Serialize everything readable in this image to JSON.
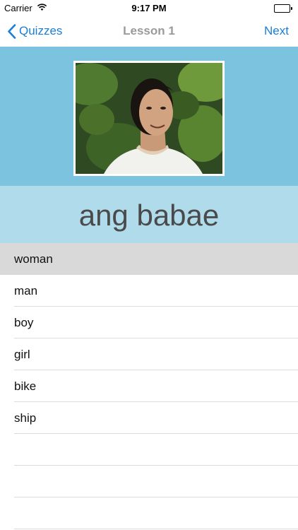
{
  "status_bar": {
    "carrier": "Carrier",
    "time": "9:17 PM",
    "wifi_icon": "wifi-icon",
    "battery_icon": "battery-icon"
  },
  "nav": {
    "back_label": "Quizzes",
    "title": "Lesson 1",
    "next_label": "Next",
    "accent_color": "#1a7ed8"
  },
  "question": {
    "word": "ang babae",
    "photo_icon": "woman-portrait-photo"
  },
  "answers": [
    {
      "label": "woman",
      "selected": true
    },
    {
      "label": "man",
      "selected": false
    },
    {
      "label": "boy",
      "selected": false
    },
    {
      "label": "girl",
      "selected": false
    },
    {
      "label": "bike",
      "selected": false
    },
    {
      "label": "ship",
      "selected": false
    }
  ],
  "colors": {
    "photo_panel": "#7cc3e0",
    "word_panel": "#b0dbeb",
    "selected_row": "#d9d9d9"
  }
}
